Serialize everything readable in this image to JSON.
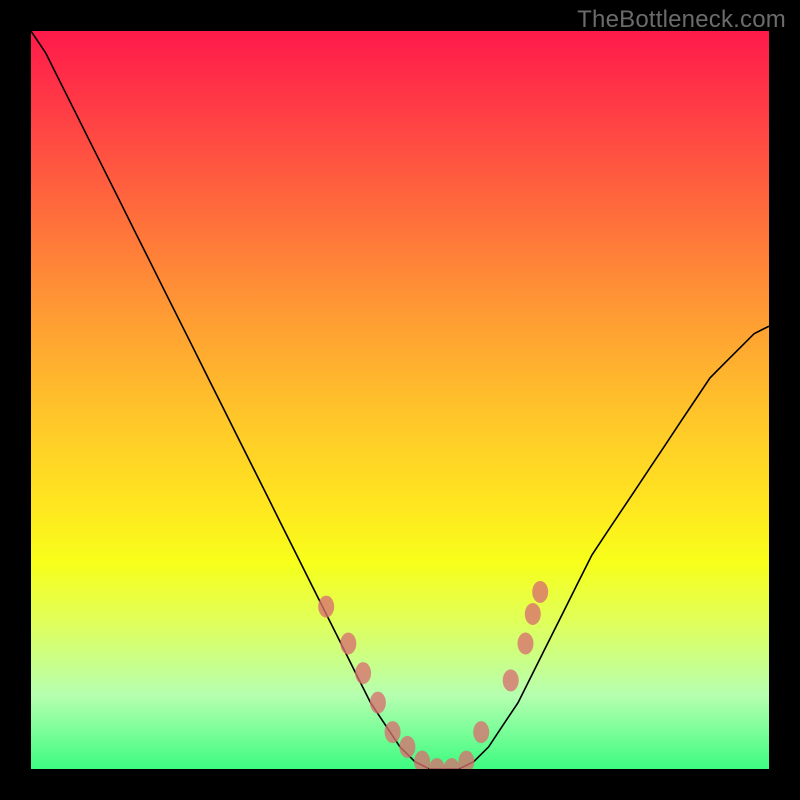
{
  "watermark": "TheBottleneck.com",
  "colors": {
    "background": "#000000",
    "gradient_top": "#ff1a4a",
    "gradient_bottom": "#3dfc80",
    "curve": "#000000",
    "markers": "#d87070"
  },
  "chart_data": {
    "type": "line",
    "title": "",
    "xlabel": "",
    "ylabel": "",
    "xlim": [
      0,
      100
    ],
    "ylim": [
      0,
      100
    ],
    "x": [
      0,
      2,
      4,
      6,
      8,
      10,
      12,
      14,
      16,
      18,
      20,
      22,
      24,
      26,
      28,
      30,
      32,
      34,
      36,
      38,
      40,
      42,
      44,
      46,
      48,
      50,
      52,
      54,
      56,
      58,
      60,
      62,
      64,
      66,
      68,
      70,
      72,
      74,
      76,
      78,
      80,
      82,
      84,
      86,
      88,
      90,
      92,
      94,
      96,
      98,
      100
    ],
    "values": [
      100,
      97,
      93,
      89,
      85,
      81,
      77,
      73,
      69,
      65,
      61,
      57,
      53,
      49,
      45,
      41,
      37,
      33,
      29,
      25,
      21,
      17,
      13,
      9,
      6,
      3,
      1,
      0,
      0,
      0,
      1,
      3,
      6,
      9,
      13,
      17,
      21,
      25,
      29,
      32,
      35,
      38,
      41,
      44,
      47,
      50,
      53,
      55,
      57,
      59,
      60
    ],
    "markers": [
      {
        "x": 40,
        "y": 22
      },
      {
        "x": 43,
        "y": 17
      },
      {
        "x": 45,
        "y": 13
      },
      {
        "x": 47,
        "y": 9
      },
      {
        "x": 49,
        "y": 5
      },
      {
        "x": 51,
        "y": 3
      },
      {
        "x": 53,
        "y": 1
      },
      {
        "x": 55,
        "y": 0
      },
      {
        "x": 57,
        "y": 0
      },
      {
        "x": 59,
        "y": 1
      },
      {
        "x": 61,
        "y": 5
      },
      {
        "x": 65,
        "y": 12
      },
      {
        "x": 67,
        "y": 17
      },
      {
        "x": 68,
        "y": 21
      },
      {
        "x": 69,
        "y": 24
      }
    ],
    "marker_rx": 8,
    "marker_ry": 11
  }
}
